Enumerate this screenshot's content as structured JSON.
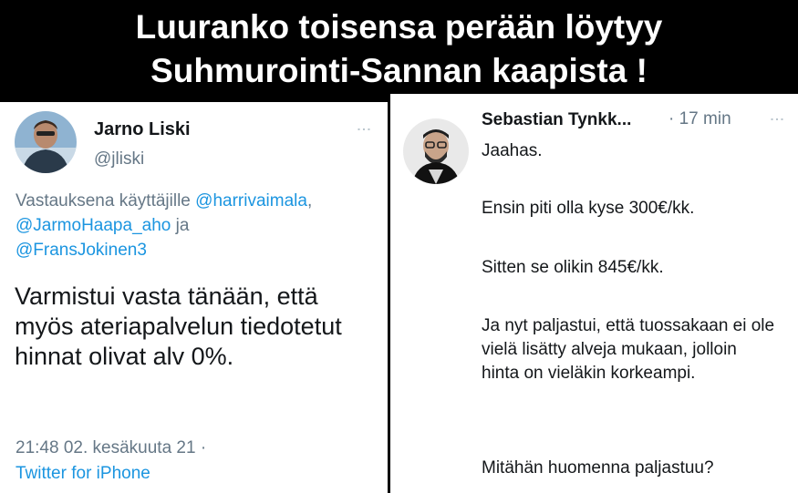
{
  "banner": {
    "line1": "Luuranko toisensa perään löytyy",
    "line2": "Suhmurointi-Sannan kaapista !"
  },
  "left_tweet": {
    "name": "Jarno Liski",
    "handle": "@jliski",
    "menu_glyph": "⋮",
    "reply_prefix": "Vastauksena käyttäjille ",
    "mention1": "@harrivaimala",
    "sep1": ",",
    "mention2": "@JarmoHaapa_aho",
    "sep2": " ja",
    "mention3": "@FransJokinen3",
    "text": "Varmistui vasta tänään, että myös ateriapalvelun tiedotetut hinnat olivat alv 0%.",
    "timestamp": "21:48 02. kesäkuuta 21 ·",
    "source": "Twitter for iPhone"
  },
  "right_post": {
    "name": "Sebastian Tynkk...",
    "time": "· 17 min",
    "menu_glyph": "⋮",
    "p1": "Jaahas.",
    "p2": "Ensin piti olla kyse 300€/kk.",
    "p3": "Sitten se olikin 845€/kk.",
    "p4": "Ja nyt paljastui, että tuossakaan ei ole vielä lisätty alveja mukaan, jolloin hinta on vieläkin korkeampi.",
    "p5": "Mitähän huomenna paljastuu?"
  }
}
